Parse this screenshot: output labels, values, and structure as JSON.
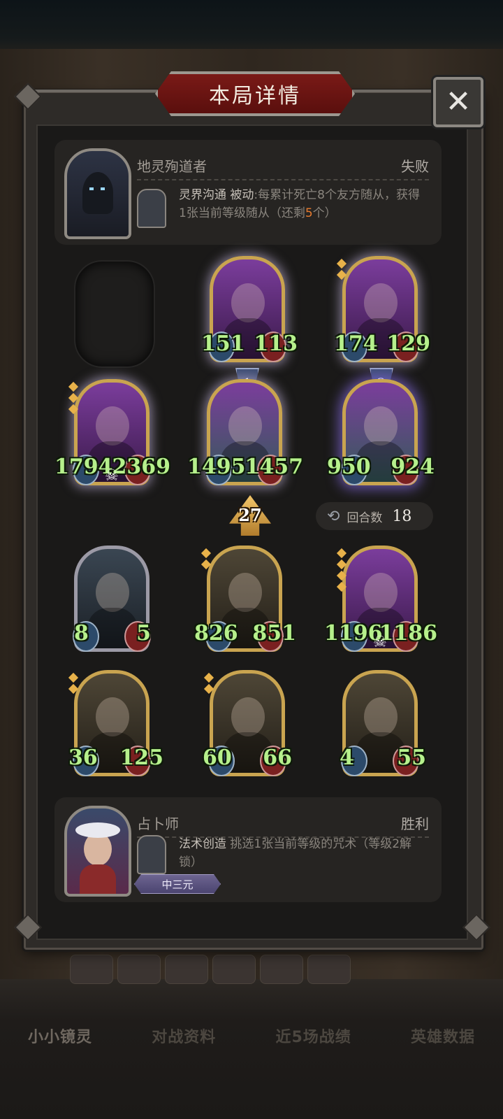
{
  "title": "本局详情",
  "close_icon": "close-icon",
  "opponent": {
    "name": "地灵殉道者",
    "result": "失败",
    "skill_name": "灵界沟通",
    "skill_type": "被动",
    "skill_desc_1": ":每累计死亡",
    "skill_count": "8",
    "skill_desc_2": "个友方随从，获得1张当前等级随从（还剩",
    "skill_remaining": "5",
    "skill_desc_3": "个）"
  },
  "opponent_board": [
    {
      "atk": "151",
      "hp": "113"
    },
    {
      "atk": "174",
      "hp": "129"
    },
    {
      "atk": "1794",
      "hp": "2369"
    },
    {
      "atk": "1495",
      "hp": "1457",
      "position": "1"
    },
    {
      "atk": "950",
      "hp": "924",
      "position": "2"
    }
  ],
  "tier": "27",
  "round": {
    "label": "回合数",
    "value": "18",
    "icon": "cycle-icon"
  },
  "player_board": [
    {
      "atk": "8",
      "hp": "5"
    },
    {
      "atk": "826",
      "hp": "851"
    },
    {
      "atk": "1196",
      "hp": "1186"
    },
    {
      "atk": "36",
      "hp": "125"
    },
    {
      "atk": "60",
      "hp": "66"
    },
    {
      "atk": "4",
      "hp": "55"
    }
  ],
  "player": {
    "name": "占卜师",
    "result": "胜利",
    "skill_name": "法术创造",
    "skill_desc": "挑选1张当前等级的咒术（等级2解锁）",
    "badge": "中三元"
  },
  "bottom_tabs": [
    "小小镜灵",
    "对战资料",
    "近5场战绩",
    "英雄数据"
  ]
}
